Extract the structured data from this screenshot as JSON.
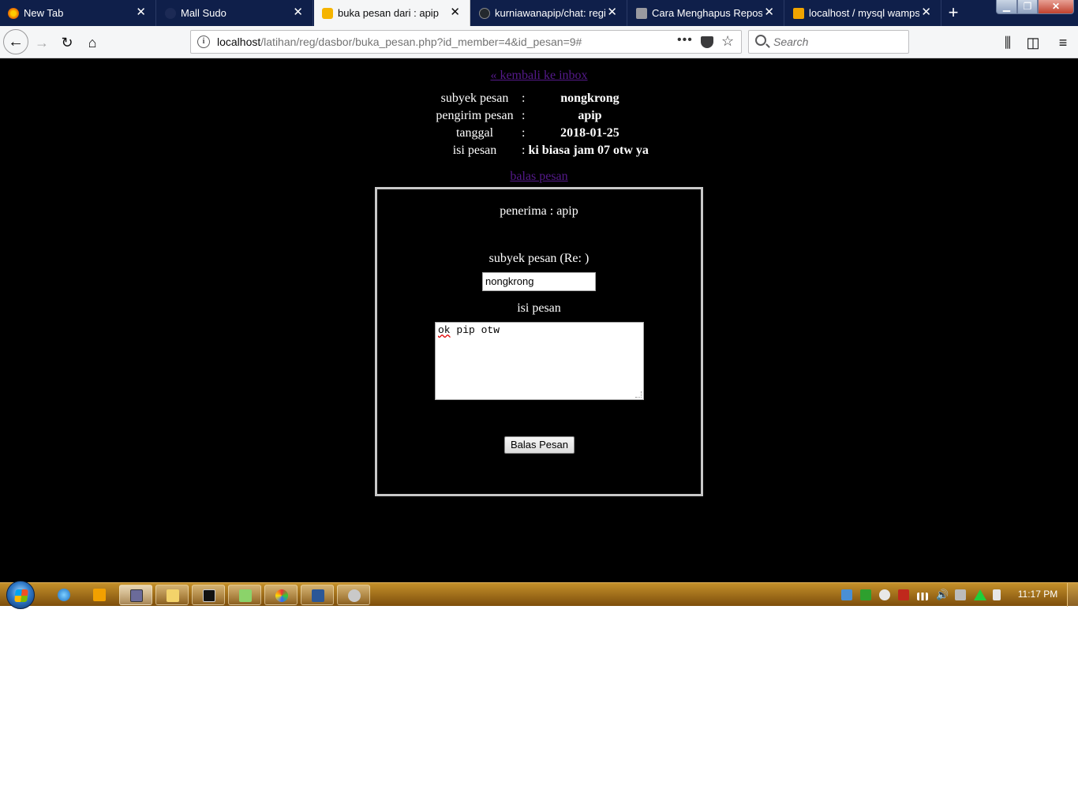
{
  "browser": {
    "tabs": [
      {
        "title": "New Tab",
        "icon": "firefox-icon",
        "active": false
      },
      {
        "title": "Mall Sudo",
        "icon": "site-icon",
        "active": false
      },
      {
        "title": "buka pesan dari : apip",
        "icon": "wampserver-icon",
        "active": true
      },
      {
        "title": "kurniawanapip/chat: regis",
        "icon": "github-icon",
        "active": false
      },
      {
        "title": "Cara Menghapus Reposito",
        "icon": "site-icon",
        "active": false
      },
      {
        "title": "localhost / mysql wampse",
        "icon": "phpmyadmin-icon",
        "active": false
      }
    ],
    "url_host": "localhost",
    "url_path": "/latihan/reg/dasbor/buka_pesan.php?id_member=4&id_pesan=9#",
    "search_placeholder": "Search"
  },
  "page": {
    "back_link": "« kembali ke inbox",
    "message": [
      {
        "label": "subyek pesan",
        "sep": ":",
        "value": "nongkrong"
      },
      {
        "label": "pengirim pesan",
        "sep": ":",
        "value": "apip"
      },
      {
        "label": "tanggal",
        "sep": ":",
        "value": "2018-01-25"
      },
      {
        "label": "isi pesan",
        "sep": ":",
        "value": "ki biasa jam 07 otw ya"
      }
    ],
    "reply_link": "balas pesan",
    "reply_form": {
      "recipient": "penerima : apip",
      "subject_label": "subyek pesan (Re: )",
      "subject_value": "nongkrong",
      "message_label": "isi pesan",
      "message_word_1": "ok",
      "message_rest": " pip otw",
      "submit_label": "Balas Pesan"
    }
  },
  "taskbar": {
    "clock": "11:17 PM"
  },
  "colors": {
    "page_background": "#000000",
    "link": "#551a8b",
    "tab_strip": "#0f1f4a",
    "taskbar": "#a46b18"
  }
}
